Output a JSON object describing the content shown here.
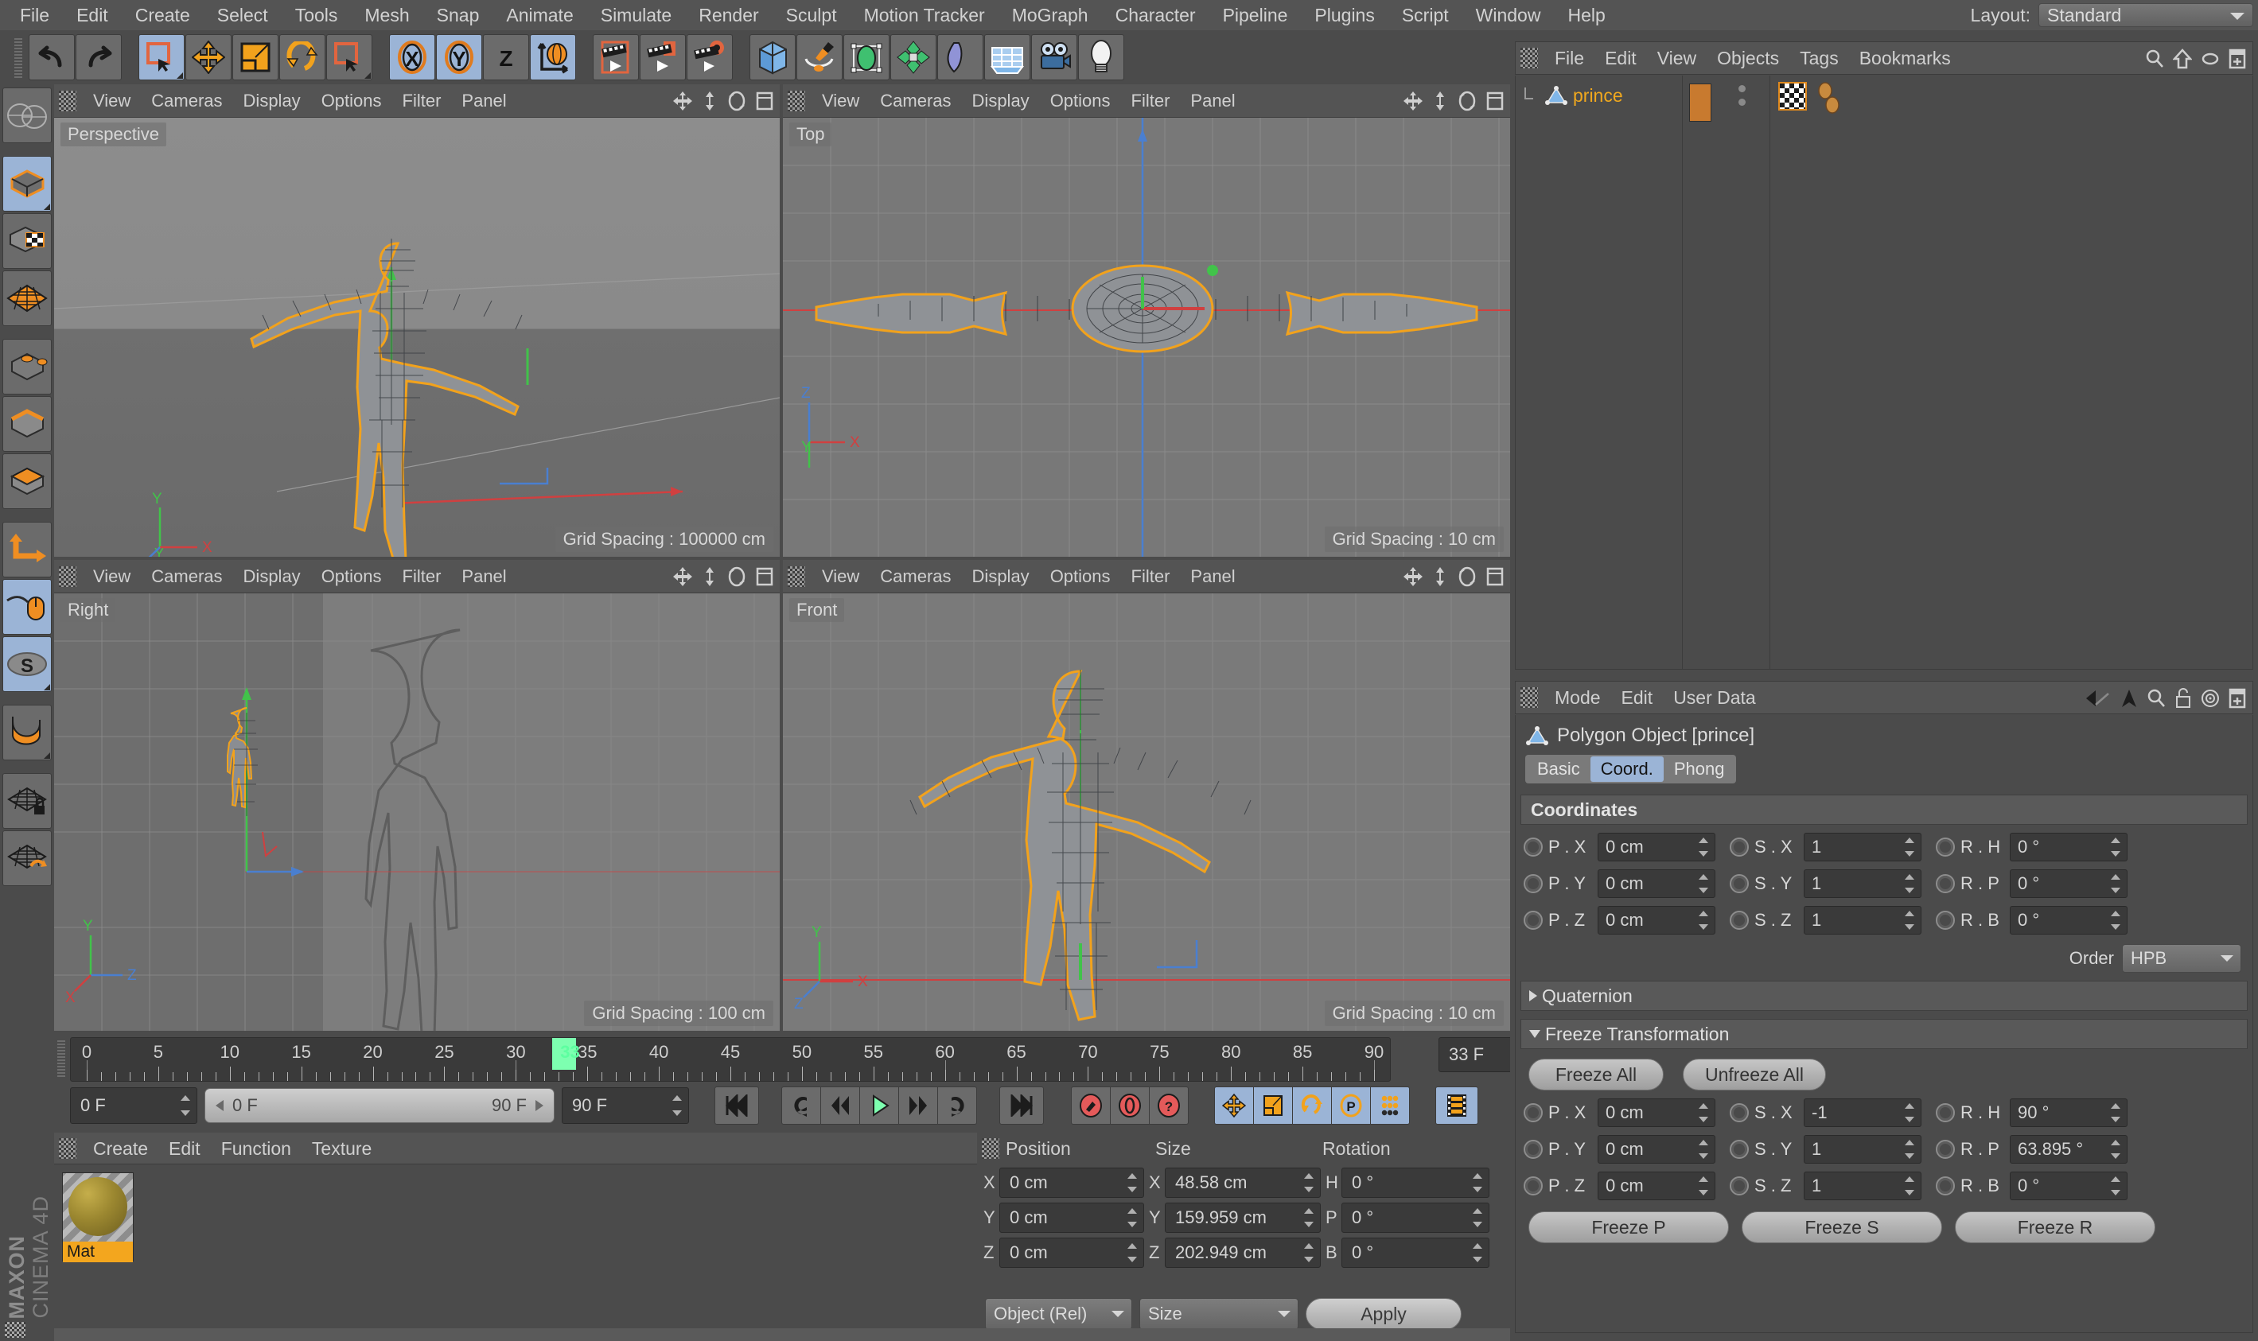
{
  "app": {
    "brand_line1": "MAXON",
    "brand_line2": "CINEMA 4D"
  },
  "menubar": {
    "items": [
      "File",
      "Edit",
      "Create",
      "Select",
      "Tools",
      "Mesh",
      "Snap",
      "Animate",
      "Simulate",
      "Render",
      "Sculpt",
      "Motion Tracker",
      "MoGraph",
      "Character",
      "Pipeline",
      "Plugins",
      "Script",
      "Window",
      "Help"
    ],
    "layout_label": "Layout:",
    "layout_value": "Standard"
  },
  "toolbar": {
    "buttons": [
      {
        "name": "undo-button",
        "icon": "undo-icon",
        "state": "normal"
      },
      {
        "name": "redo-button",
        "icon": "redo-icon",
        "state": "normal"
      },
      {
        "name": "live-selection-button",
        "icon": "live-selection-icon",
        "state": "selected"
      },
      {
        "name": "move-tool-button",
        "icon": "move-icon",
        "state": "normal"
      },
      {
        "name": "scale-tool-button",
        "icon": "scale-icon",
        "state": "normal"
      },
      {
        "name": "rotate-tool-button",
        "icon": "rotate-icon",
        "state": "normal"
      },
      {
        "name": "selection-tool-button",
        "icon": "rect-selection-icon",
        "state": "normal"
      },
      {
        "name": "lock-x-axis-button",
        "icon": "x-axis-icon",
        "state": "selected"
      },
      {
        "name": "lock-y-axis-button",
        "icon": "y-axis-icon",
        "state": "selected"
      },
      {
        "name": "lock-z-axis-button",
        "icon": "z-axis-icon",
        "state": "normal"
      },
      {
        "name": "world-object-coordinate-button",
        "icon": "world-coordinate-icon",
        "state": "selected"
      },
      {
        "name": "render-view-button",
        "icon": "render-view-icon",
        "state": "normal"
      },
      {
        "name": "render-to-picture-viewer-button",
        "icon": "render-picture-viewer-icon",
        "state": "normal"
      },
      {
        "name": "render-settings-button",
        "icon": "render-settings-icon",
        "state": "normal"
      },
      {
        "name": "add-cube-button",
        "icon": "cube-icon",
        "state": "normal"
      },
      {
        "name": "add-spline-button",
        "icon": "pen-spline-icon",
        "state": "normal"
      },
      {
        "name": "add-nurbs-button",
        "icon": "nurbs-icon",
        "state": "normal"
      },
      {
        "name": "add-array-button",
        "icon": "array-icon",
        "state": "normal"
      },
      {
        "name": "add-bend-deformer-button",
        "icon": "bend-deformer-icon",
        "state": "normal"
      },
      {
        "name": "add-floor-button",
        "icon": "floor-icon",
        "state": "normal"
      },
      {
        "name": "add-camera-button",
        "icon": "camera-icon",
        "state": "normal"
      },
      {
        "name": "add-light-button",
        "icon": "light-icon",
        "state": "normal"
      }
    ]
  },
  "left_toolbar": {
    "buttons": [
      {
        "name": "make-editable-button",
        "icon": "make-editable-icon",
        "state": "normal"
      },
      {
        "name": "model-mode-button",
        "icon": "model-mode-icon",
        "state": "selected"
      },
      {
        "name": "texture-mode-button",
        "icon": "texture-mode-icon",
        "state": "normal"
      },
      {
        "name": "workplane-mode-button",
        "icon": "workplane-mode-icon",
        "state": "normal"
      },
      {
        "name": "points-mode-button",
        "icon": "points-mode-icon",
        "state": "normal"
      },
      {
        "name": "edges-mode-button",
        "icon": "edges-mode-icon",
        "state": "normal"
      },
      {
        "name": "polygons-mode-button",
        "icon": "polygons-mode-icon",
        "state": "normal"
      },
      {
        "name": "object-axis-button",
        "icon": "object-axis-icon",
        "state": "normal"
      },
      {
        "name": "enable-snap-button",
        "icon": "mouse-snap-icon",
        "state": "selected"
      },
      {
        "name": "soft-selection-button",
        "icon": "soft-selection-icon",
        "state": "selected"
      },
      {
        "name": "magnet-button",
        "icon": "magnet-icon",
        "state": "normal"
      },
      {
        "name": "workplane-lock-button",
        "icon": "workplane-lock-icon",
        "state": "normal"
      },
      {
        "name": "workplane-align-button",
        "icon": "workplane-align-icon",
        "state": "normal"
      }
    ]
  },
  "viewports": {
    "menu_items": [
      "View",
      "Cameras",
      "Display",
      "Options",
      "Filter",
      "Panel"
    ],
    "panels": [
      {
        "name": "perspective-viewport",
        "label": "Perspective",
        "grid_spacing": "Grid Spacing : 100000 cm"
      },
      {
        "name": "top-viewport",
        "label": "Top",
        "grid_spacing": "Grid Spacing : 10 cm"
      },
      {
        "name": "right-viewport",
        "label": "Right",
        "grid_spacing": "Grid Spacing : 100 cm"
      },
      {
        "name": "front-viewport",
        "label": "Front",
        "grid_spacing": "Grid Spacing : 10 cm"
      }
    ]
  },
  "timeline": {
    "ticks": [
      0,
      5,
      10,
      15,
      20,
      25,
      30,
      35,
      40,
      45,
      50,
      55,
      60,
      65,
      70,
      75,
      80,
      85,
      90
    ],
    "range_start": 0,
    "range_end": 90,
    "playhead_frame": 33,
    "playhead_label": "33",
    "current_frame_field": "33 F",
    "start_field": "0 F",
    "range_bar_left": "0 F",
    "range_bar_right": "90 F",
    "end_field": "90 F",
    "transport": [
      {
        "name": "go-to-start-button",
        "icon": "skip-to-start-icon"
      },
      {
        "name": "play-backwards-loop-button",
        "icon": "loop-back-icon"
      },
      {
        "name": "previous-frame-button",
        "icon": "step-back-icon"
      },
      {
        "name": "play-button",
        "icon": "play-icon"
      },
      {
        "name": "next-frame-button",
        "icon": "step-forward-icon"
      },
      {
        "name": "loop-forward-button",
        "icon": "loop-forward-icon"
      },
      {
        "name": "go-to-end-button",
        "icon": "skip-to-end-icon"
      },
      {
        "name": "record-active-objects-button",
        "icon": "record-key-icon"
      },
      {
        "name": "autokeying-button",
        "icon": "autokey-icon"
      },
      {
        "name": "keyframe-selection-button",
        "icon": "question-key-icon"
      },
      {
        "name": "record-position-button",
        "icon": "position-key-icon"
      },
      {
        "name": "record-scale-button",
        "icon": "scale-key-icon"
      },
      {
        "name": "record-rotation-button",
        "icon": "rotation-key-icon"
      },
      {
        "name": "record-param-button",
        "icon": "param-key-icon"
      },
      {
        "name": "record-pla-button",
        "icon": "pla-key-icon"
      },
      {
        "name": "timeline-button",
        "icon": "timeline-filmstrip-icon"
      }
    ]
  },
  "material_manager": {
    "menu_items": [
      "Create",
      "Edit",
      "Function",
      "Texture"
    ],
    "materials": [
      {
        "name": "Mat"
      }
    ]
  },
  "coordinates_panel": {
    "headers": [
      "Position",
      "Size",
      "Rotation"
    ],
    "rows": [
      {
        "axis": "X",
        "position": "0 cm",
        "size_axis": "X",
        "size": "48.58 cm",
        "rot_axis": "H",
        "rotation": "0 °"
      },
      {
        "axis": "Y",
        "position": "0 cm",
        "size_axis": "Y",
        "size": "159.959 cm",
        "rot_axis": "P",
        "rotation": "0 °"
      },
      {
        "axis": "Z",
        "position": "0 cm",
        "size_axis": "Z",
        "size": "202.949 cm",
        "rot_axis": "B",
        "rotation": "0 °"
      }
    ],
    "mode_select": "Object (Rel)",
    "size_select": "Size",
    "apply_label": "Apply"
  },
  "object_manager": {
    "menu_items": [
      "File",
      "Edit",
      "View",
      "Objects",
      "Tags",
      "Bookmarks"
    ],
    "objects": [
      {
        "name": "prince"
      }
    ]
  },
  "attribute_manager": {
    "menu_items": [
      "Mode",
      "Edit",
      "User Data"
    ],
    "title": "Polygon Object [prince]",
    "tabs": [
      {
        "label": "Basic",
        "active": false
      },
      {
        "label": "Coord.",
        "active": true
      },
      {
        "label": "Phong",
        "active": false
      }
    ],
    "coordinates_header": "Coordinates",
    "coord_rows": [
      {
        "p_label": "P . X",
        "p_value": "0 cm",
        "s_label": "S . X",
        "s_value": "1",
        "r_label": "R . H",
        "r_value": "0 °"
      },
      {
        "p_label": "P . Y",
        "p_value": "0 cm",
        "s_label": "S . Y",
        "s_value": "1",
        "r_label": "R . P",
        "r_value": "0 °"
      },
      {
        "p_label": "P . Z",
        "p_value": "0 cm",
        "s_label": "S . Z",
        "s_value": "1",
        "r_label": "R . B",
        "r_value": "0 °"
      }
    ],
    "order_label": "Order",
    "order_value": "HPB",
    "quaternion_label": "Quaternion",
    "freeze_header": "Freeze Transformation",
    "freeze_all_label": "Freeze All",
    "unfreeze_all_label": "Unfreeze All",
    "freeze_rows": [
      {
        "p_label": "P . X",
        "p_value": "0 cm",
        "s_label": "S . X",
        "s_value": "-1",
        "r_label": "R . H",
        "r_value": "90 °"
      },
      {
        "p_label": "P . Y",
        "p_value": "0 cm",
        "s_label": "S . Y",
        "s_value": "1",
        "r_label": "R . P",
        "r_value": "63.895 °"
      },
      {
        "p_label": "P . Z",
        "p_value": "0 cm",
        "s_label": "S . Z",
        "s_value": "1",
        "r_label": "R . B",
        "r_value": "0 °"
      }
    ],
    "freeze_p_label": "Freeze P",
    "freeze_s_label": "Freeze S",
    "freeze_r_label": "Freeze R"
  },
  "colors": {
    "accent_orange": "#f0a81e",
    "selection_blue": "#9bb4d6",
    "panel_bg": "#4b4b4b",
    "header_bg": "#545454",
    "field_bg": "#3a3a3a",
    "playhead_green": "#7dffb0"
  }
}
